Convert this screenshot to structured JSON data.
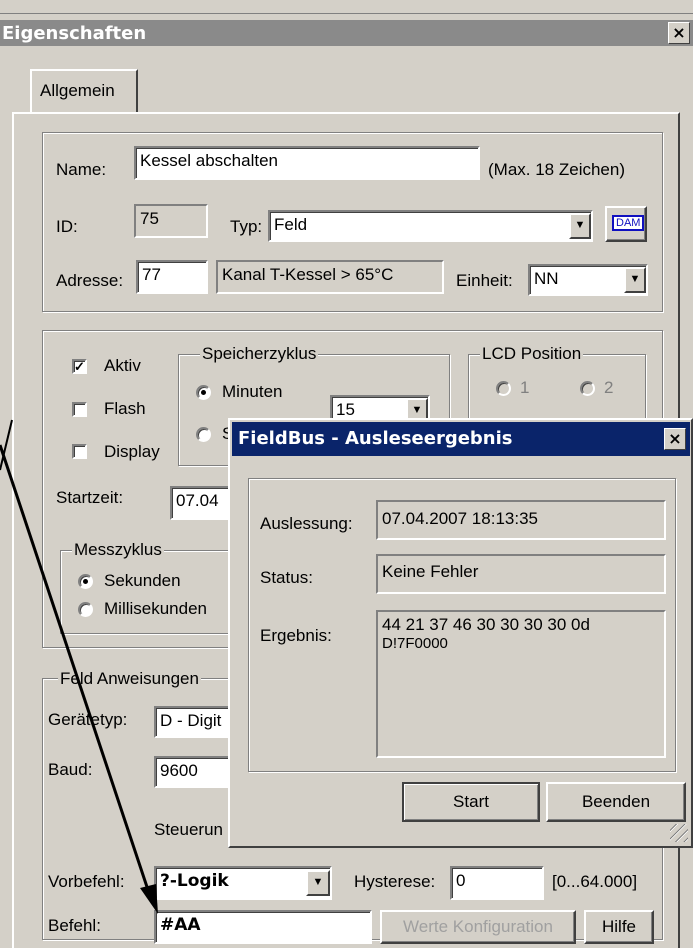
{
  "window": {
    "title": "Eigenschaften",
    "close_glyph": "×"
  },
  "tabs": [
    {
      "label": "Allgemein"
    }
  ],
  "general": {
    "name_label": "Name:",
    "name_value": "Kessel abschalten",
    "name_hint": "(Max. 18 Zeichen)",
    "id_label": "ID:",
    "id_value": "75",
    "type_label": "Typ:",
    "type_value": "Feld",
    "dam_label": "DAM",
    "address_label": "Adresse:",
    "address_value": "77",
    "channel_value": "Kanal T-Kessel > 65°C",
    "unit_label": "Einheit:",
    "unit_value": "NN"
  },
  "options": {
    "aktiv_label": "Aktiv",
    "aktiv_checked": true,
    "flash_label": "Flash",
    "flash_checked": false,
    "display_label": "Display",
    "display_checked": false,
    "storage_legend": "Speicherzyklus",
    "minutes_label": "Minuten",
    "seconds_label": "S",
    "interval_value": "15",
    "lcd_legend": "LCD Position",
    "lcd_1": "1",
    "lcd_2": "2",
    "start_label": "Startzeit:",
    "start_value": "07.04",
    "measure_legend": "Messzyklus",
    "sec_label": "Sekunden",
    "msec_label": "Millisekunden"
  },
  "field": {
    "legend": "Feld Anweisungen",
    "device_label": "Gerätetyp:",
    "device_value": "D - Digit",
    "baud_label": "Baud:",
    "baud_value": "9600",
    "steuer_label": "Steuerun",
    "pre_label": "Vorbefehl:",
    "pre_value": "?-Logik",
    "hyst_label": "Hysterese:",
    "hyst_value": "0",
    "hyst_range": "[0...64.000]",
    "cmd_label": "Befehl:",
    "cmd_value": "#AA",
    "config_button": "Werte Konfiguration",
    "help_button": "Hilfe"
  },
  "dialog": {
    "title": "FieldBus - Ausleseergebnis",
    "close_glyph": "×",
    "read_label": "Auslessung:",
    "read_value": "07.04.2007 18:13:35",
    "status_label": "Status:",
    "status_value": "Keine Fehler",
    "result_label": "Ergebnis:",
    "result_line1": "44 21 37 46 30 30 30 30 0d",
    "result_line2": "D!7F0000",
    "start_button": "Start",
    "end_button": "Beenden"
  },
  "colors": {
    "dialog_title": "#0a246a",
    "main_title_inactive": "#8a8a8a",
    "face": "#d4d0c8"
  },
  "annotation": {
    "type": "arrow",
    "color": "#000000"
  }
}
